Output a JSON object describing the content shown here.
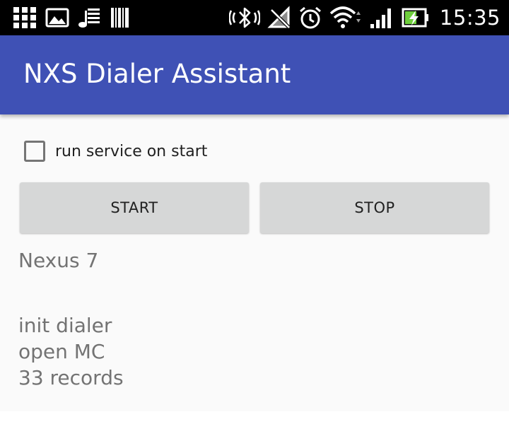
{
  "status_bar": {
    "time": "15:35",
    "left_icons": [
      "grid-apps-icon",
      "image-icon",
      "music-queue-icon",
      "barcode-icon"
    ],
    "right_icons": [
      "vibrate-bluetooth-icon",
      "muted-icon",
      "alarm-clock-icon",
      "wifi-icon",
      "cellular-signal-icon",
      "battery-charging-icon"
    ],
    "battery_level": 0.6
  },
  "app_bar": {
    "title": "NXS Dialer Assistant",
    "color": "#3f51b5"
  },
  "main": {
    "checkbox": {
      "label": "run service on start",
      "checked": false
    },
    "start_label": "START",
    "stop_label": "STOP",
    "device_name": "Nexus 7",
    "log": [
      "init dialer",
      "open MC",
      "33 records"
    ]
  }
}
